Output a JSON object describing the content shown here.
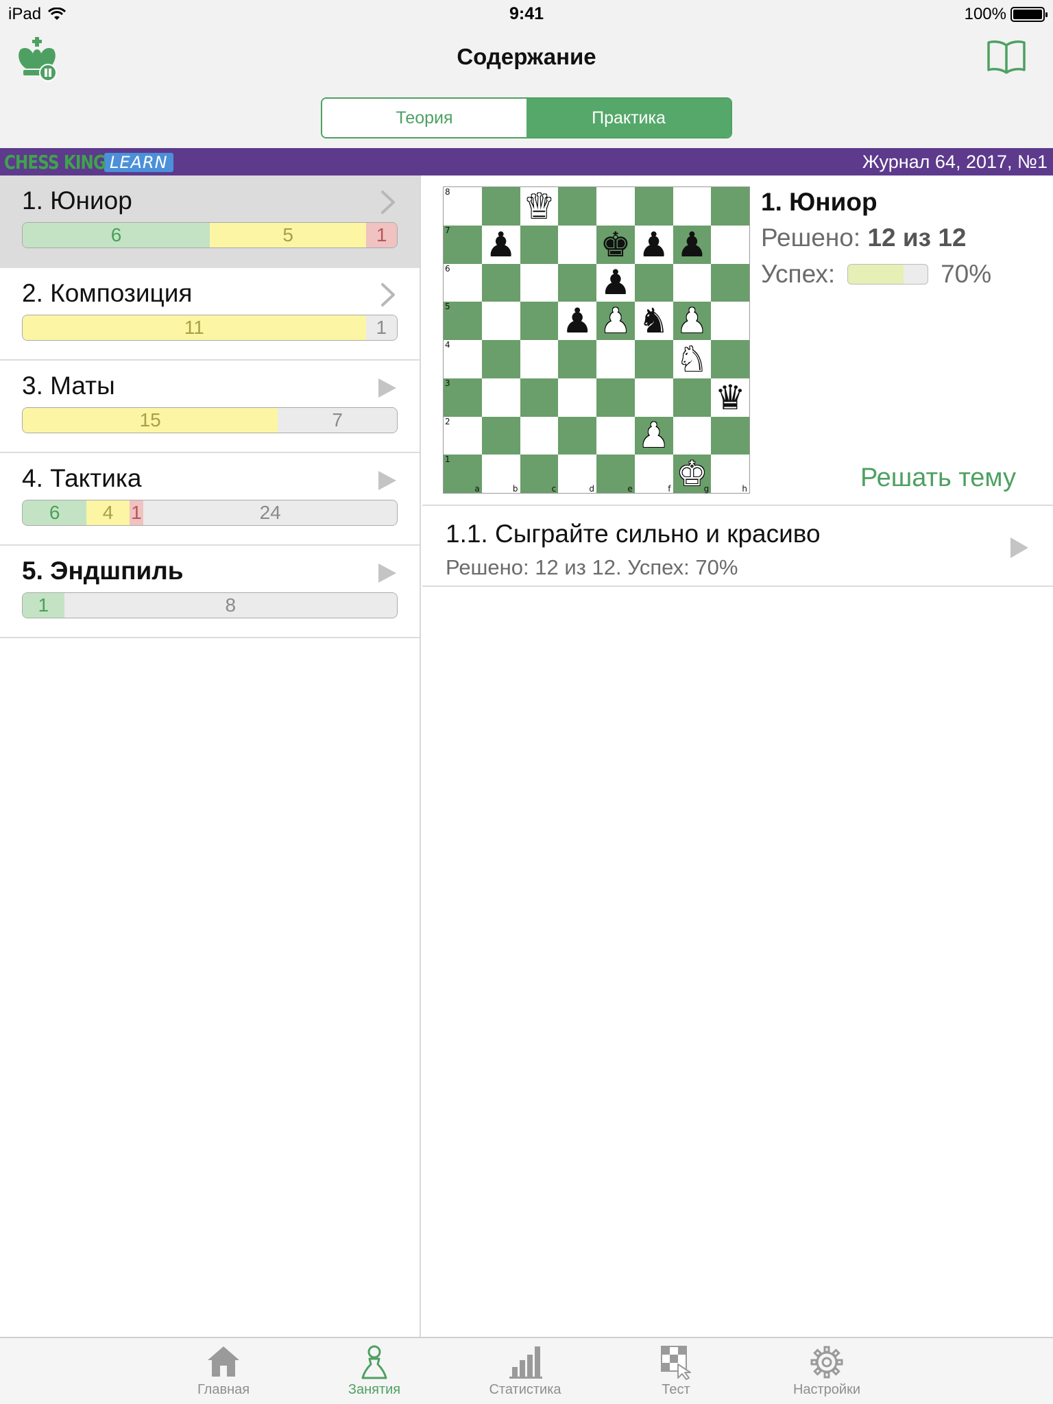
{
  "status_bar": {
    "device": "iPad",
    "time": "9:41",
    "battery": "100%"
  },
  "nav": {
    "title": "Содержание",
    "segments": [
      "Теория",
      "Практика"
    ],
    "active_segment": 1
  },
  "banner": {
    "brand": "CHESS KING",
    "brand_tag": "LEARN",
    "journal": "Журнал 64, 2017, №1"
  },
  "topics": [
    {
      "title": "1. Юниор",
      "bold": false,
      "accessory": "chevron",
      "selected": true,
      "segments": [
        {
          "value": "6",
          "kind": "green",
          "fraction": 0.5
        },
        {
          "value": "5",
          "kind": "yellow",
          "fraction": 0.418
        },
        {
          "value": "1",
          "kind": "red",
          "fraction": 0.082
        }
      ]
    },
    {
      "title": "2. Композиция",
      "bold": false,
      "accessory": "chevron",
      "selected": false,
      "segments": [
        {
          "value": "11",
          "kind": "yellow",
          "fraction": 0.917
        },
        {
          "value": "1",
          "kind": "gray",
          "fraction": 0.083
        }
      ]
    },
    {
      "title": "3. Маты",
      "bold": false,
      "accessory": "play",
      "selected": false,
      "segments": [
        {
          "value": "15",
          "kind": "yellow",
          "fraction": 0.682
        },
        {
          "value": "7",
          "kind": "gray",
          "fraction": 0.318
        }
      ]
    },
    {
      "title": "4. Тактика",
      "bold": false,
      "accessory": "play",
      "selected": false,
      "segments": [
        {
          "value": "6",
          "kind": "green",
          "fraction": 0.171
        },
        {
          "value": "4",
          "kind": "yellow",
          "fraction": 0.114
        },
        {
          "value": "1",
          "kind": "red",
          "fraction": 0.038
        },
        {
          "value": "24",
          "kind": "gray",
          "fraction": 0.677
        }
      ]
    },
    {
      "title": "5. Эндшпиль",
      "bold": true,
      "accessory": "play",
      "selected": false,
      "segments": [
        {
          "value": "1",
          "kind": "green",
          "fraction": 0.111
        },
        {
          "value": "8",
          "kind": "gray",
          "fraction": 0.889
        }
      ]
    }
  ],
  "detail": {
    "title": "1. Юниор",
    "solved_label": "Решено:",
    "solved_value": "12 из 12",
    "success_label": "Успех:",
    "success_fraction": 0.7,
    "success_value": "70%",
    "solve_button": "Решать тему",
    "sub_items": [
      {
        "title": "1.1. Сыграйте сильно и красиво",
        "subtitle": "Решено: 12 из 12. Успех: 70%"
      }
    ]
  },
  "board": {
    "ranks": [
      "8",
      "7",
      "6",
      "5",
      "4",
      "3",
      "2",
      "1"
    ],
    "files": [
      "a",
      "b",
      "c",
      "d",
      "e",
      "f",
      "g",
      "h"
    ],
    "pieces": [
      {
        "square": "c8",
        "piece": "Q"
      },
      {
        "square": "b7",
        "piece": "p"
      },
      {
        "square": "e7",
        "piece": "k"
      },
      {
        "square": "f7",
        "piece": "p"
      },
      {
        "square": "g7",
        "piece": "p"
      },
      {
        "square": "e6",
        "piece": "p"
      },
      {
        "square": "d5",
        "piece": "p"
      },
      {
        "square": "e5",
        "piece": "P"
      },
      {
        "square": "f5",
        "piece": "n"
      },
      {
        "square": "g5",
        "piece": "P"
      },
      {
        "square": "g4",
        "piece": "N"
      },
      {
        "square": "h3",
        "piece": "q"
      },
      {
        "square": "f2",
        "piece": "P"
      },
      {
        "square": "g1",
        "piece": "K"
      }
    ]
  },
  "tabs": [
    {
      "label": "Главная",
      "icon": "home-icon",
      "active": false
    },
    {
      "label": "Занятия",
      "icon": "pawn-icon",
      "active": true
    },
    {
      "label": "Статистика",
      "icon": "bar-chart-icon",
      "active": false
    },
    {
      "label": "Тест",
      "icon": "checkerboard-tap-icon",
      "active": false
    },
    {
      "label": "Настройки",
      "icon": "gear-icon",
      "active": false
    }
  ],
  "colors": {
    "accent": "#4ea062",
    "banner": "#5d3a8c",
    "board_dark": "#6a9e6a",
    "green": "#c4e3c4",
    "yellow": "#fbf5a4",
    "red": "#f0c2c2"
  }
}
